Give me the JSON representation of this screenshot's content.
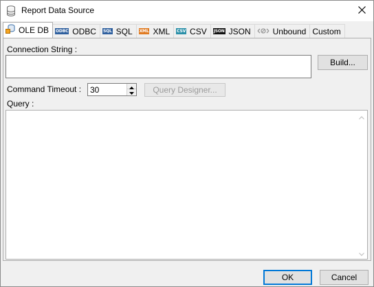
{
  "window": {
    "title": "Report Data Source",
    "icon": "database-icon",
    "close_icon": "close-icon"
  },
  "tabs": [
    {
      "label": "OLE DB",
      "icon": "oledb-icon",
      "badge": ""
    },
    {
      "label": "ODBC",
      "icon": "odbc-icon",
      "badge": "ODBC"
    },
    {
      "label": "SQL",
      "icon": "sql-icon",
      "badge": "SQL"
    },
    {
      "label": "XML",
      "icon": "xml-icon",
      "badge": "XML"
    },
    {
      "label": "CSV",
      "icon": "csv-icon",
      "badge": "CSV"
    },
    {
      "label": "JSON",
      "icon": "json-icon",
      "badge": "JSON"
    },
    {
      "label": "Unbound",
      "icon": "unbound-icon",
      "badge": ""
    },
    {
      "label": "Custom",
      "icon": "",
      "badge": ""
    }
  ],
  "active_tab": "OLE DB",
  "form": {
    "connection_string_label": "Connection String :",
    "connection_string_value": "",
    "build_button": "Build...",
    "command_timeout_label": "Command Timeout :",
    "command_timeout_value": "30",
    "query_designer_button": "Query Designer...",
    "query_label": "Query :",
    "query_value": ""
  },
  "footer": {
    "ok_button": "OK",
    "cancel_button": "Cancel"
  },
  "colors": {
    "accent": "#0078d7",
    "panel_bg": "#f0f0f0",
    "odbc": "#2e5f9e",
    "sql": "#2e5f9e",
    "xml": "#e07b22",
    "csv": "#2a8fa8",
    "json": "#111111"
  }
}
